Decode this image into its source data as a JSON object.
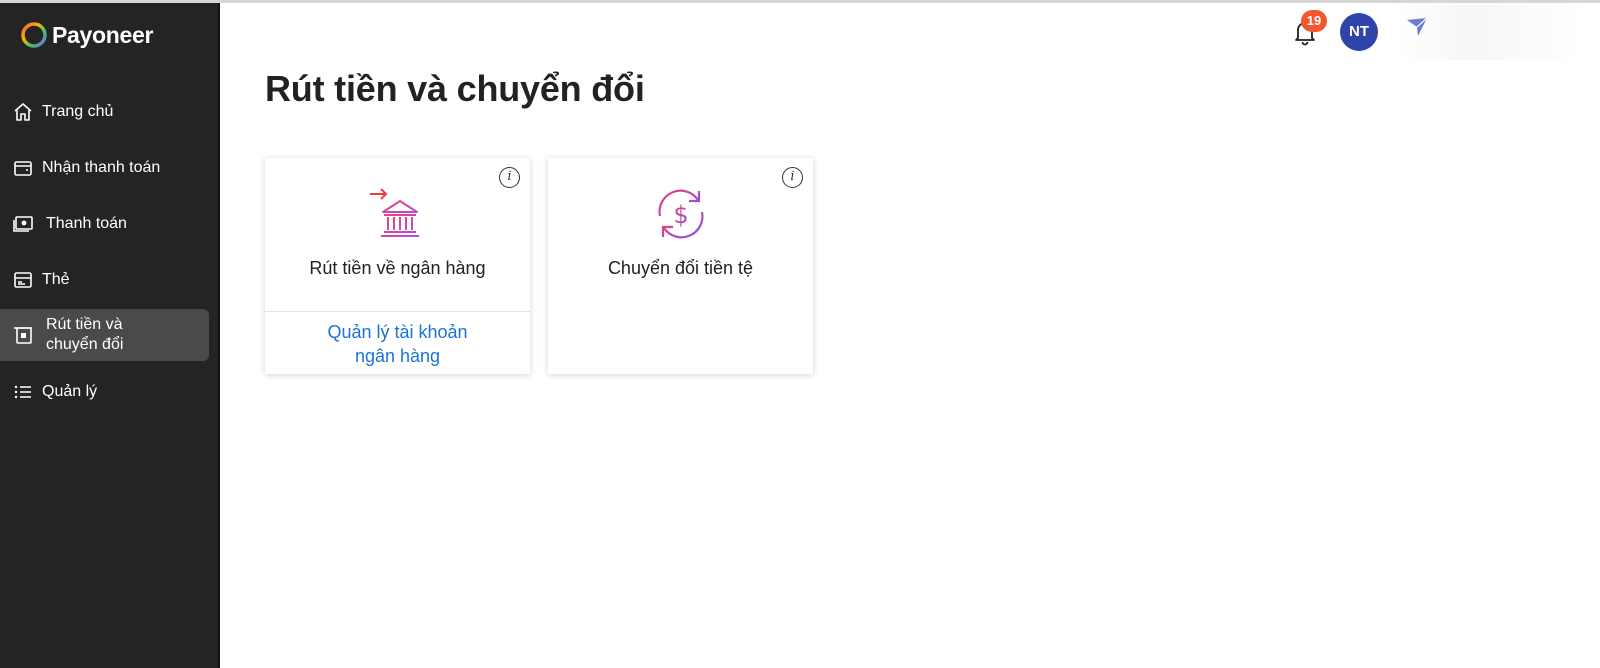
{
  "brand": {
    "name": "Payoneer"
  },
  "sidebar": {
    "items": [
      {
        "label": "Trang chủ",
        "icon": "home-icon"
      },
      {
        "label": "Nhận thanh toán",
        "icon": "wallet-icon"
      },
      {
        "label": "Thanh toán",
        "icon": "payment-icon"
      },
      {
        "label": "Thẻ",
        "icon": "card-icon"
      },
      {
        "label_line1": "Rút tiền và",
        "label_line2": "chuyển đổi",
        "icon": "withdraw-icon",
        "active": true
      },
      {
        "label": "Quản lý",
        "icon": "list-icon"
      }
    ]
  },
  "header": {
    "notification_count": "19",
    "avatar_initials": "NT"
  },
  "main": {
    "title": "Rút tiền và chuyển đổi",
    "cards": [
      {
        "title": "Rút tiền về ngân hàng",
        "icon": "bank-transfer-icon",
        "info": "i",
        "link_line1": "Quản lý tài khoản",
        "link_line2": "ngân hàng"
      },
      {
        "title": "Chuyển đổi tiền tệ",
        "icon": "currency-exchange-icon",
        "info": "i"
      }
    ]
  },
  "colors": {
    "sidebar_bg": "#242424",
    "active_item_bg": "#4a4a4a",
    "badge": "#f2572e",
    "avatar": "#2f44a8",
    "link": "#1a73d8",
    "accent_pink": "#e2389b",
    "accent_purple": "#8a52e8"
  }
}
